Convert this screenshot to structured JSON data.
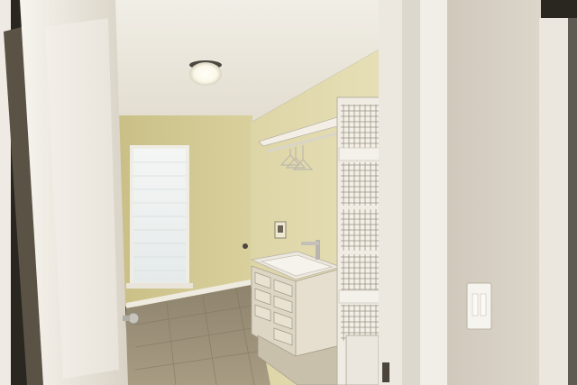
{
  "scene": {
    "kind": "photo",
    "subject": "laundry-room",
    "elements": [
      "ceiling-light",
      "window-blind",
      "utility-sink",
      "shelving-unit",
      "light-switch",
      "tile-floor",
      "open-door"
    ]
  },
  "palette": {
    "wall": "#d8cf9c",
    "wall_shadow": "#b9b07c",
    "ceiling": "#ece8dc",
    "door": "#ece7dd",
    "floor": "#9c8f76",
    "trim": "#f2efe6",
    "right_wall": "#d6d0c4"
  }
}
